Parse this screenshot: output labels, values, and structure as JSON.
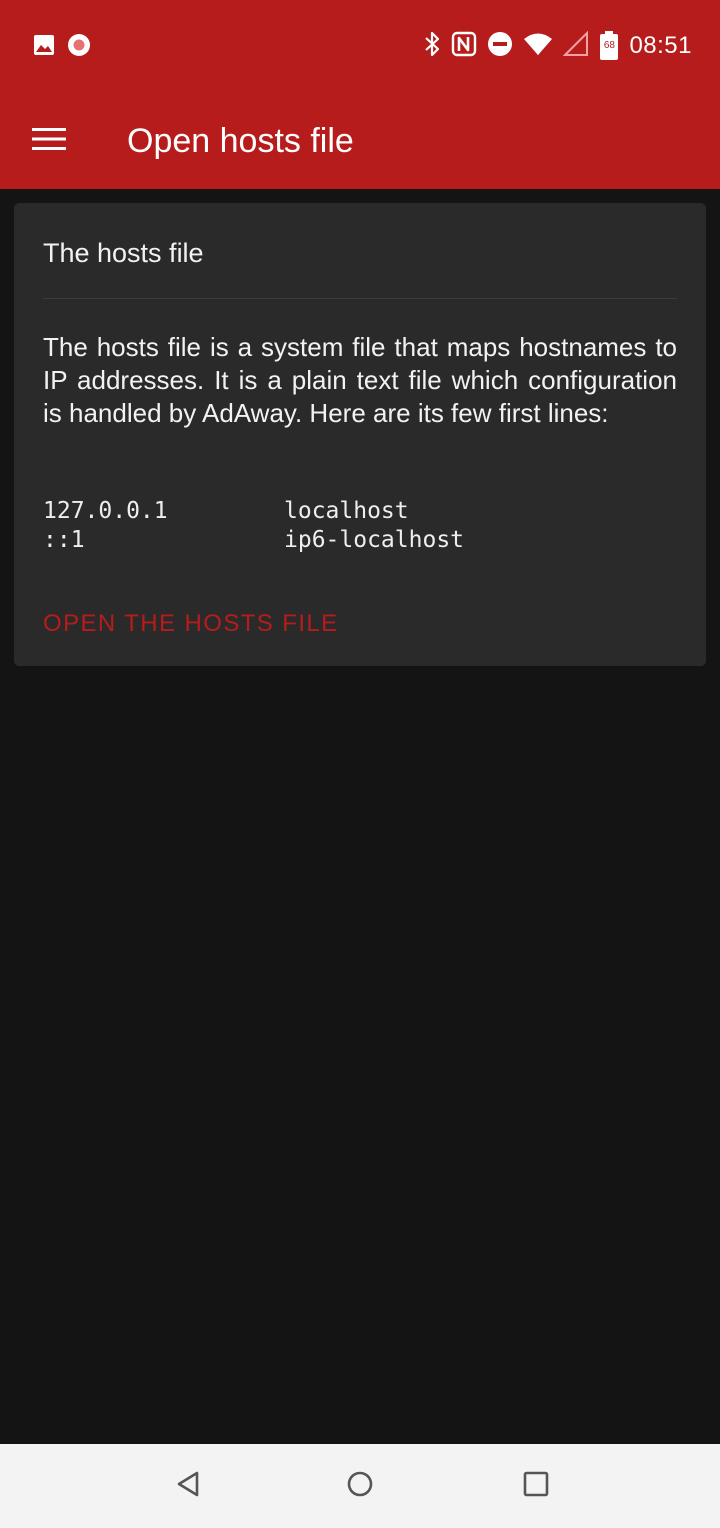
{
  "status_bar": {
    "time": "08:51",
    "battery_level": "68",
    "icons": [
      "image-icon",
      "record-icon",
      "bluetooth-icon",
      "nfc-icon",
      "do-not-disturb-icon",
      "wifi-icon",
      "signal-icon",
      "battery-icon"
    ]
  },
  "toolbar": {
    "title": "Open hosts file",
    "menu_icon": "menu-icon"
  },
  "card": {
    "title": "The hosts file",
    "description": "The hosts file is a system file that maps hostnames to IP addresses. It is a plain text file which configuration is handled by AdAway. Here are its few first lines:",
    "lines": [
      {
        "ip": "127.0.0.1",
        "host": "localhost"
      },
      {
        "ip": "::1",
        "host": "ip6-localhost"
      }
    ],
    "button_label": "OPEN THE HOSTS FILE"
  },
  "nav_bar": {
    "icons": [
      "back-icon",
      "home-icon",
      "recents-icon"
    ]
  },
  "colors": {
    "primary": "#b71c1c",
    "background": "#141414",
    "card": "#2a2a2a",
    "nav_bar": "#f3f3f3"
  }
}
